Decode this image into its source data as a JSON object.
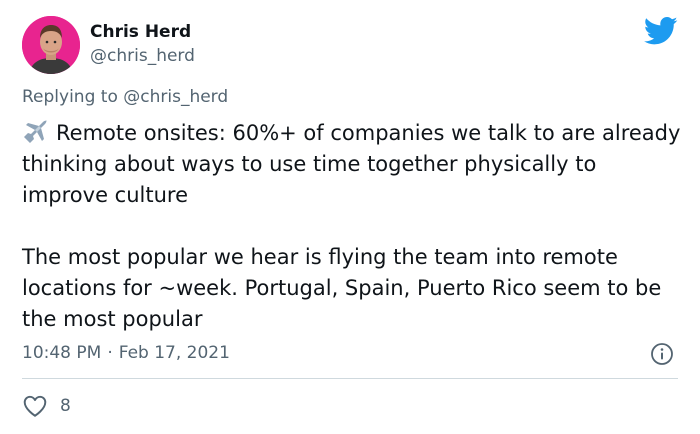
{
  "author": {
    "name": "Chris Herd",
    "handle": "@chris_herd",
    "avatar_icon": "profile-photo",
    "avatar_bg": "#e8248f"
  },
  "platform_icon": "twitter-bird-icon",
  "brand_color": "#1d9bf0",
  "reply": {
    "prefix": "Replying to",
    "handle": "@chris_herd"
  },
  "body": {
    "emoji_icon": "airplane-icon",
    "paragraph1": "Remote onsites: 60%+ of companies we talk to are already thinking about ways to use time together physically to improve culture",
    "paragraph2": "The most popular we hear is flying the team into remote locations for ~week. Portugal, Spain, Puerto Rico seem to be the most popular"
  },
  "meta": {
    "time": "10:48 PM",
    "separator": "·",
    "date": "Feb 17, 2021"
  },
  "actions": {
    "like_icon": "heart-icon",
    "like_count": "8",
    "info_icon": "info-icon"
  }
}
